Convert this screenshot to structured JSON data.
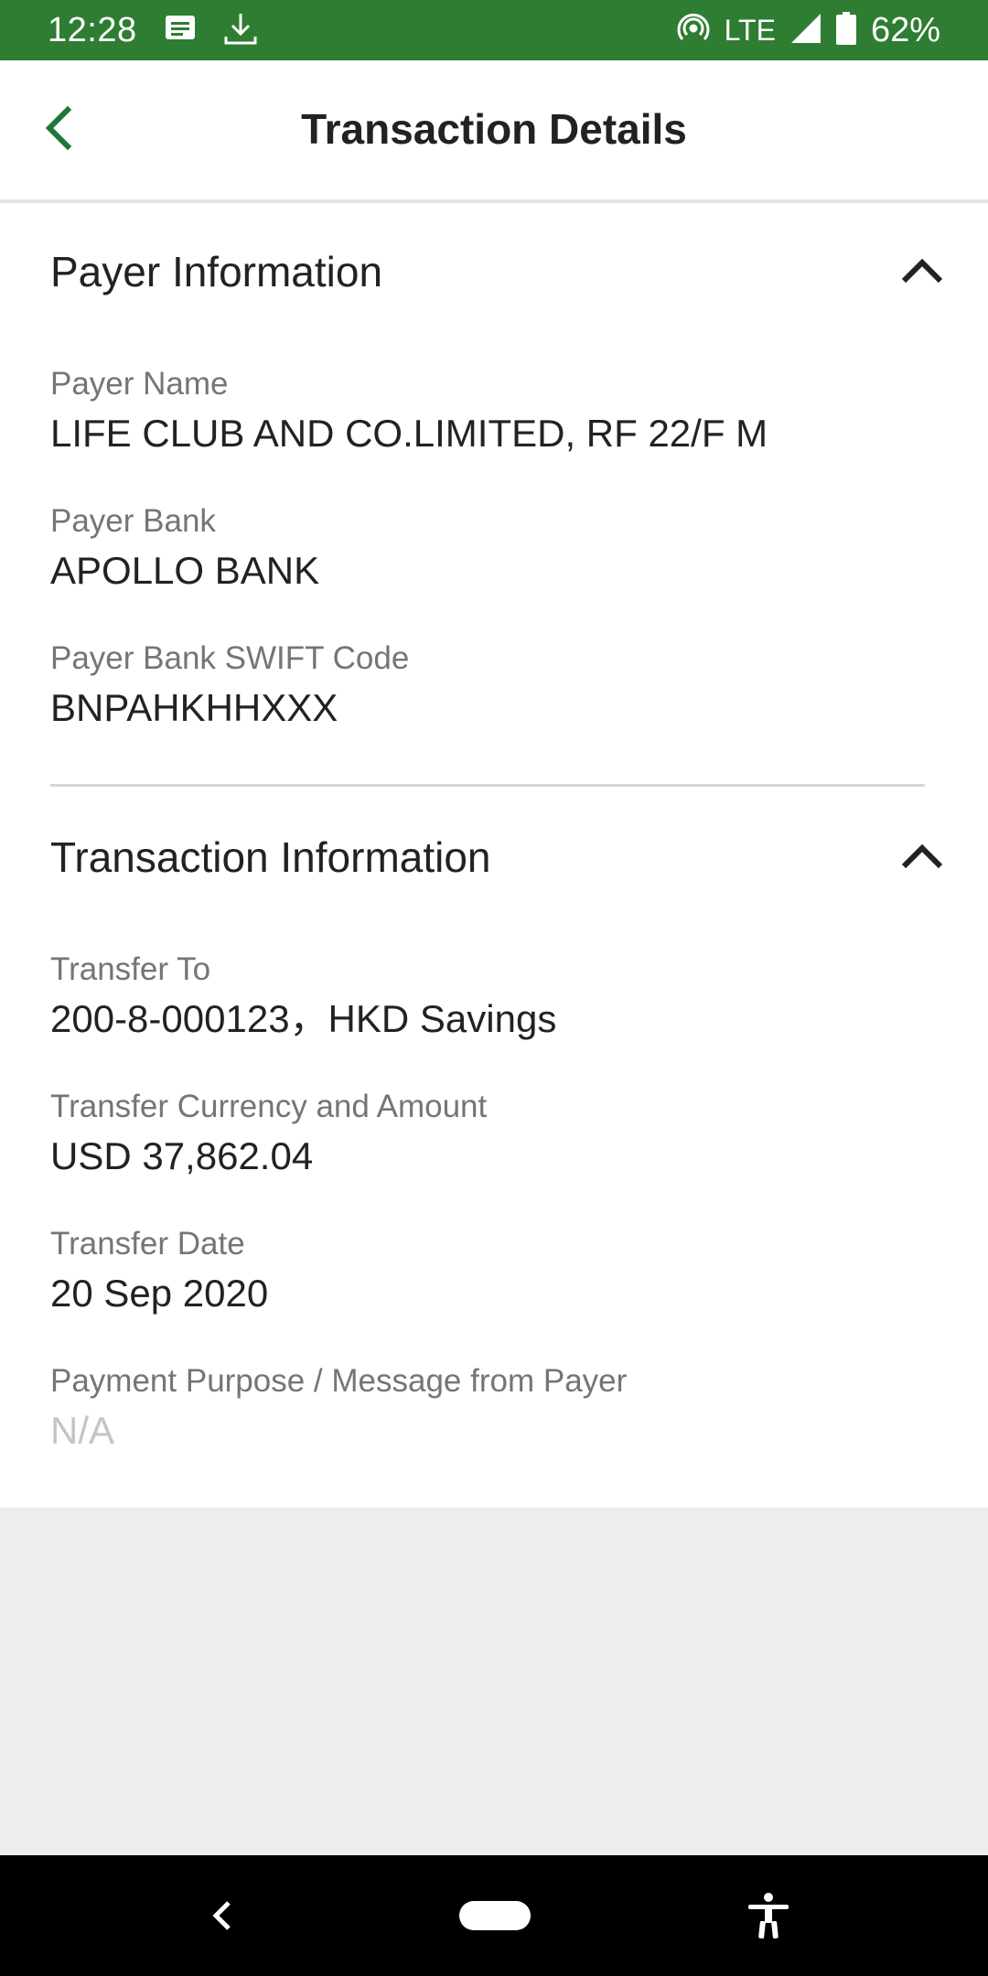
{
  "status_bar": {
    "time": "12:28",
    "network": "LTE",
    "battery": "62%",
    "icons": [
      "message-icon",
      "download-icon",
      "hotspot-icon",
      "signal-icon",
      "battery-icon"
    ]
  },
  "header": {
    "title": "Transaction Details",
    "back_icon": "chevron-left-icon"
  },
  "payer_section": {
    "title": "Payer Information",
    "toggle_icon": "chevron-up-icon",
    "fields": [
      {
        "label": "Payer Name",
        "value": "LIFE CLUB AND CO.LIMITED, RF 22/F M"
      },
      {
        "label": "Payer Bank",
        "value": "APOLLO BANK"
      },
      {
        "label": "Payer Bank SWIFT Code",
        "value": "BNPAHKHHXXX"
      }
    ]
  },
  "transaction_section": {
    "title": "Transaction Information",
    "toggle_icon": "chevron-up-icon",
    "fields": [
      {
        "label": "Transfer To",
        "value": "200-8-000123，HKD Savings"
      },
      {
        "label": "Transfer Currency and Amount",
        "value": "USD 37,862.04"
      },
      {
        "label": "Transfer Date",
        "value": "20 Sep 2020"
      },
      {
        "label": "Payment Purpose / Message from Payer",
        "value": "N/A"
      }
    ]
  },
  "colors": {
    "status_bar": "#2e7d32",
    "accent": "#1b7a36",
    "text_primary": "#222222",
    "text_label": "#757575",
    "text_muted": "#c4c4c4",
    "background": "#ededed"
  }
}
